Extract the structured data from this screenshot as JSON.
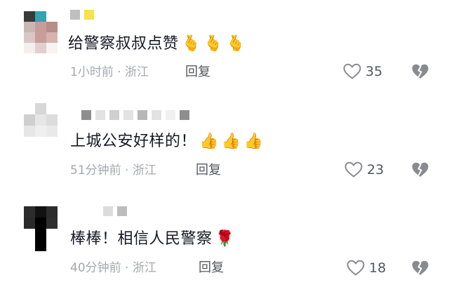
{
  "comments": [
    {
      "text": "给警察叔叔点赞",
      "emojis": [
        "🫰",
        "🫰",
        "🫰"
      ],
      "time": "1小时前",
      "location": "浙江",
      "reply_label": "回复",
      "likes": "35",
      "avatar_colors": [
        "#3a3a3a",
        "#3aa0b4",
        "#ffffff",
        "#c9b7b4",
        "#c79d9a",
        "#b88c88",
        "#d8c7c5",
        "#c89d9b",
        "#d7b2ae",
        "#f4eeee",
        "#e0cfcd",
        "#f7f3f3"
      ],
      "username_colors": [
        "#bfbfbf",
        "#f6e24a"
      ]
    },
    {
      "text": "上城公安好样的！",
      "emojis": [
        "👍",
        "👍",
        "👍"
      ],
      "time": "51分钟前",
      "location": "浙江",
      "reply_label": "回复",
      "likes": "23",
      "avatar_colors": [
        "#ffffff",
        "#d7d7d7",
        "#ffffff",
        "#cfcfcf",
        "#e6e6e6",
        "#dcdcdc",
        "#e6e6e6",
        "#efefef",
        "#e9e9e9"
      ],
      "username_colors": [
        "#8e8e8e",
        "#e2e2e2",
        "#cfcfcf",
        "#e2e2e2",
        "#b7b7b7",
        "#e2e2e2",
        "#f0f0f0",
        "#8e8e8e"
      ]
    },
    {
      "text": "棒棒！相信人民警察",
      "emojis": [
        "🌹"
      ],
      "time": "40分钟前",
      "location": "浙江",
      "reply_label": "回复",
      "likes": "18",
      "avatar_colors": [
        "#2c2c2c",
        "#111111",
        "#2c2c2c",
        "#2a2a2a",
        "#000000",
        "#2e2e2e",
        "#ffffff",
        "#000000",
        "#ffffff",
        "#ffffff",
        "#000000",
        "#ffffff"
      ],
      "username_colors": [
        "#dcdcdc",
        "#bdbdbd"
      ]
    }
  ],
  "separator": " · ",
  "icons": {
    "like": "heart-outline-icon",
    "dislike": "broken-heart-icon"
  }
}
